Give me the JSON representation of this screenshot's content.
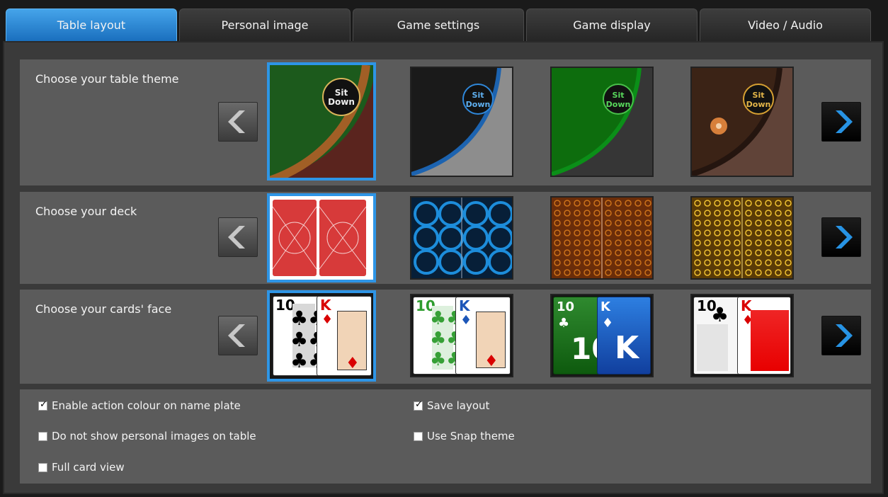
{
  "tabs": [
    {
      "label": "Table layout",
      "active": true
    },
    {
      "label": "Personal image",
      "active": false
    },
    {
      "label": "Game settings",
      "active": false
    },
    {
      "label": "Game display",
      "active": false
    },
    {
      "label": "Video / Audio",
      "active": false
    }
  ],
  "sections": {
    "theme": {
      "label": "Choose your table theme",
      "sit_label": "Sit\nDown"
    },
    "deck": {
      "label": "Choose your deck"
    },
    "face": {
      "label": "Choose your cards' face"
    }
  },
  "theme_items": [
    {
      "name": "classic-green-wood",
      "sit_color": "#d9b45a",
      "selected": true
    },
    {
      "name": "dark-blue",
      "sit_color": "#3f8ed8",
      "selected": false
    },
    {
      "name": "neon-green",
      "sit_color": "#49c04a",
      "selected": false
    },
    {
      "name": "brown-pattern",
      "sit_color": "#d6a032",
      "selected": false
    }
  ],
  "deck_items": [
    {
      "name": "red-bicycle",
      "color": "#d63a3a",
      "selected": true
    },
    {
      "name": "blue-circles",
      "color": "#1d8ddb",
      "selected": false
    },
    {
      "name": "orange-circles",
      "color": "#d77a1d",
      "selected": false
    },
    {
      "name": "gold-circles",
      "color": "#e5b42a",
      "selected": false
    }
  ],
  "face_items": [
    {
      "name": "classic-face",
      "ten": "10",
      "king": "K",
      "selected": true
    },
    {
      "name": "green-blue-face",
      "ten": "10",
      "king": "K",
      "selected": false
    },
    {
      "name": "big-index-face",
      "ten": "10",
      "king": "K",
      "selected": false
    },
    {
      "name": "simple-face",
      "ten": "10",
      "king": "K",
      "selected": false
    }
  ],
  "options": {
    "enable_action_colour": {
      "label": "Enable action colour on name plate",
      "checked": true
    },
    "do_not_show_images": {
      "label": "Do not show personal images on table",
      "checked": false
    },
    "full_card_view": {
      "label": "Full card view",
      "checked": false
    },
    "save_layout": {
      "label": "Save layout",
      "checked": true
    },
    "use_snap_theme": {
      "label": "Use Snap theme",
      "checked": false
    }
  }
}
